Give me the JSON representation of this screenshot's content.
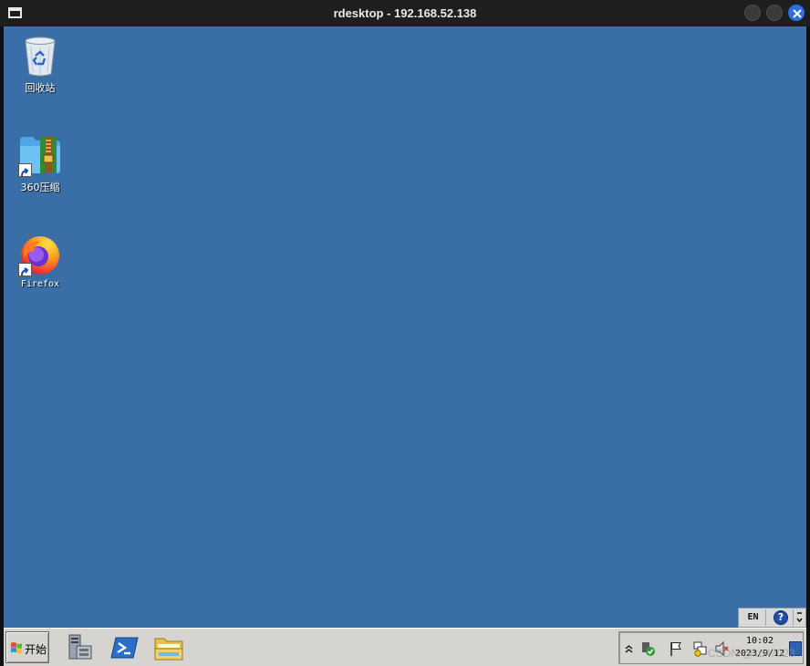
{
  "window": {
    "title": "rdesktop - 192.168.52.138"
  },
  "desktop": {
    "background_color": "#396ea6",
    "icons": [
      {
        "label": "回收站",
        "icon": "recycle-bin-icon"
      },
      {
        "label": "360压缩",
        "icon": "360-compress-icon",
        "shortcut": true
      },
      {
        "label": "Firefox",
        "icon": "firefox-icon",
        "shortcut": true
      }
    ]
  },
  "language_bar": {
    "language": "EN",
    "help_symbol": "?"
  },
  "taskbar": {
    "start_label": "开始",
    "pinned": [
      {
        "icon": "server-manager-icon"
      },
      {
        "icon": "powershell-icon"
      },
      {
        "icon": "file-explorer-icon"
      }
    ],
    "tray": {
      "time": "10:02",
      "date": "2023/9/12"
    }
  },
  "overlay": {
    "watermark_text": "CSDN @kd47023"
  }
}
